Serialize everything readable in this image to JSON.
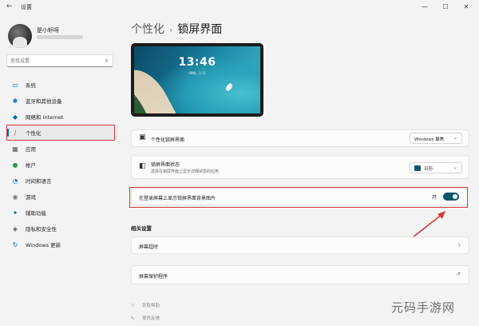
{
  "window": {
    "back_icon": "←",
    "title": "设置",
    "controls": [
      "—",
      "☐",
      "✕"
    ]
  },
  "user": {
    "name": "是小轩呀"
  },
  "search": {
    "placeholder": "查找设置"
  },
  "nav": [
    {
      "icon": "system-icon",
      "glyph": "▭",
      "color": "#0067c0",
      "label": "系统",
      "active": false
    },
    {
      "icon": "bluetooth-icon",
      "glyph": "✱",
      "color": "#0067c0",
      "label": "蓝牙和其他设备",
      "active": false
    },
    {
      "icon": "wifi-icon",
      "glyph": "◆",
      "color": "#0067c0",
      "label": "网络和 Internet",
      "active": false
    },
    {
      "icon": "brush-icon",
      "glyph": "/",
      "color": "#c0392b",
      "label": "个性化",
      "active": true
    },
    {
      "icon": "apps-icon",
      "glyph": "▦",
      "color": "#555555",
      "label": "应用",
      "active": false
    },
    {
      "icon": "account-icon",
      "glyph": "●",
      "color": "#2e9e5b",
      "label": "帐户",
      "active": false
    },
    {
      "icon": "clock-icon",
      "glyph": "◔",
      "color": "#0067c0",
      "label": "时间和语言",
      "active": false
    },
    {
      "icon": "gamepad-icon",
      "glyph": "◉",
      "color": "#777777",
      "label": "游戏",
      "active": false
    },
    {
      "icon": "accessibility-icon",
      "glyph": "✦",
      "color": "#0067c0",
      "label": "辅助功能",
      "active": false
    },
    {
      "icon": "shield-icon",
      "glyph": "◈",
      "color": "#555555",
      "label": "隐私和安全性",
      "active": false
    },
    {
      "icon": "windows-update-icon",
      "glyph": "↻",
      "color": "#0067c0",
      "label": "Windows 更新",
      "active": false
    }
  ],
  "breadcrumb": {
    "parent": "个性化",
    "separator": "›",
    "current": "锁屏界面"
  },
  "preview": {
    "time": "13:46",
    "date": "VINIL, 1:11"
  },
  "settings": {
    "personalize": {
      "title": "个性化锁屏界面",
      "value": "Windows 聚焦",
      "chevron": "⌄"
    },
    "status": {
      "title": "锁屏界面状态",
      "subtitle": "选择在锁屏界面上显示详细状态的应用",
      "value": "日历",
      "chevron": "⌄"
    },
    "show_background": {
      "title": "在登录屏幕上显示锁屏界面背景图片",
      "toggle_label": "开",
      "toggle_on": true
    }
  },
  "related": {
    "heading": "相关设置",
    "items": [
      {
        "title": "屏幕超时",
        "action_glyph": "›"
      },
      {
        "title": "屏幕保护程序",
        "action_glyph": "↗"
      }
    ]
  },
  "footer": [
    {
      "icon": "help-icon",
      "glyph": "☉",
      "label": "获取帮助"
    },
    {
      "icon": "feedback-icon",
      "glyph": "✎",
      "label": "提供反馈"
    }
  ],
  "watermark": "元码手游网",
  "colors": {
    "accent": "#0067c0",
    "toggle": "#0b5568",
    "highlight": "#d23a3a"
  }
}
